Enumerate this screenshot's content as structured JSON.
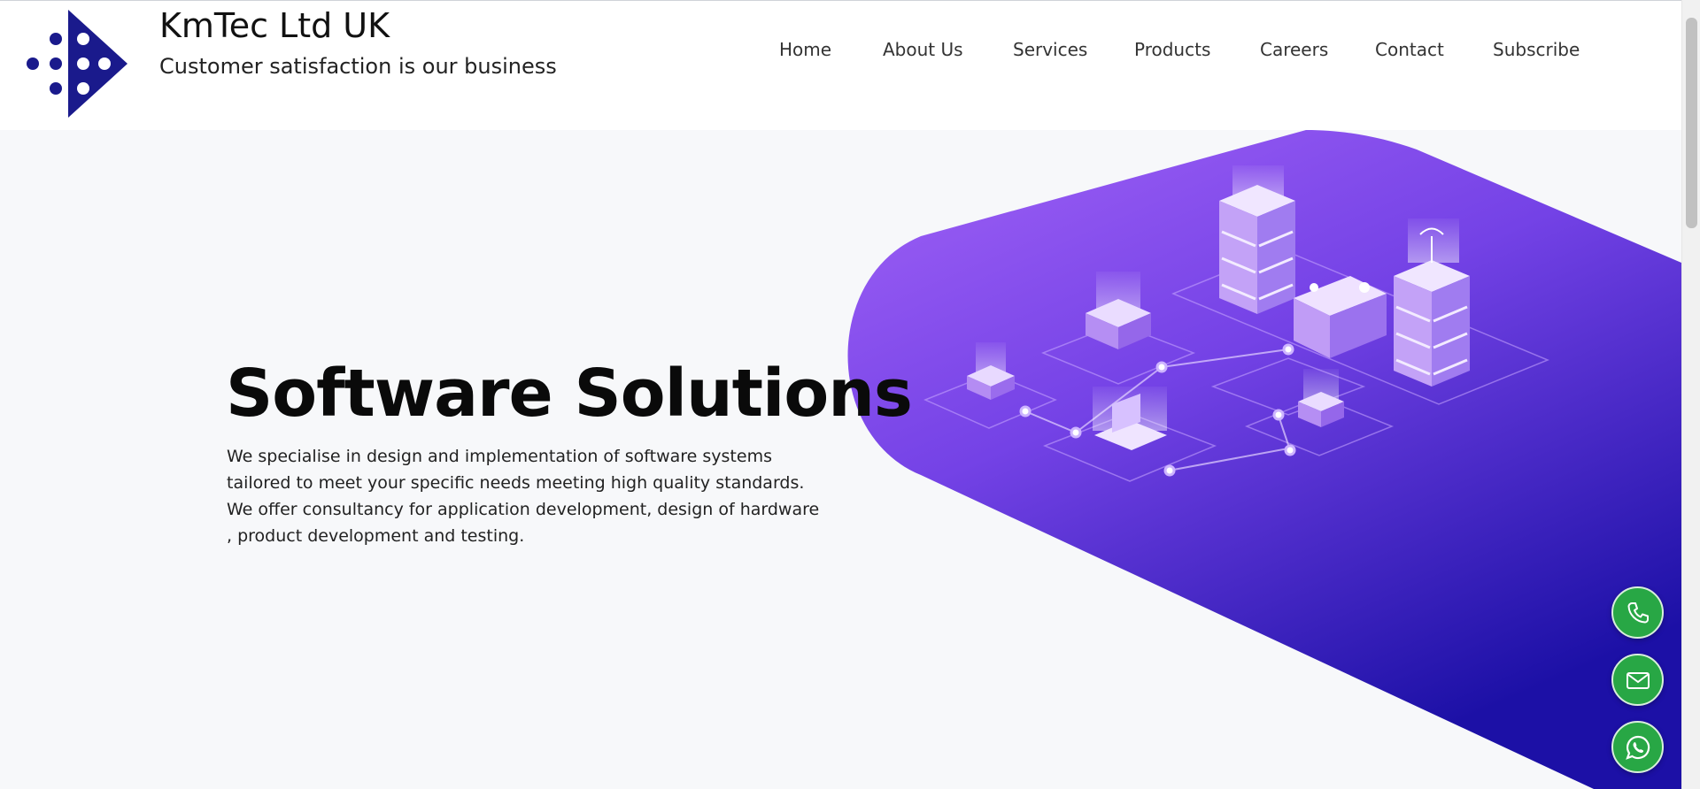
{
  "brand": {
    "name": "KmTec Ltd UK",
    "tagline": "Customer satisfaction is our business",
    "logo_color": "#1a1a8c"
  },
  "nav": {
    "items": [
      {
        "label": "Home"
      },
      {
        "label": "About Us"
      },
      {
        "label": "Services"
      },
      {
        "label": "Products"
      },
      {
        "label": "Careers"
      },
      {
        "label": "Contact"
      },
      {
        "label": "Subscribe"
      }
    ]
  },
  "hero": {
    "title": "Software Solutions",
    "description": "We specialise in design and implementation of software systems tailored to meet your specific needs meeting high quality standards. We offer consultancy for application development, design of hardware , product development and testing.",
    "gradient_colors": [
      "#9a5cf5",
      "#6a3ce0",
      "#1d12a8"
    ]
  },
  "floating_actions": [
    {
      "icon": "phone-icon",
      "color": "#28a745"
    },
    {
      "icon": "mail-icon",
      "color": "#28a745"
    },
    {
      "icon": "whatsapp-icon",
      "color": "#28a745"
    }
  ]
}
